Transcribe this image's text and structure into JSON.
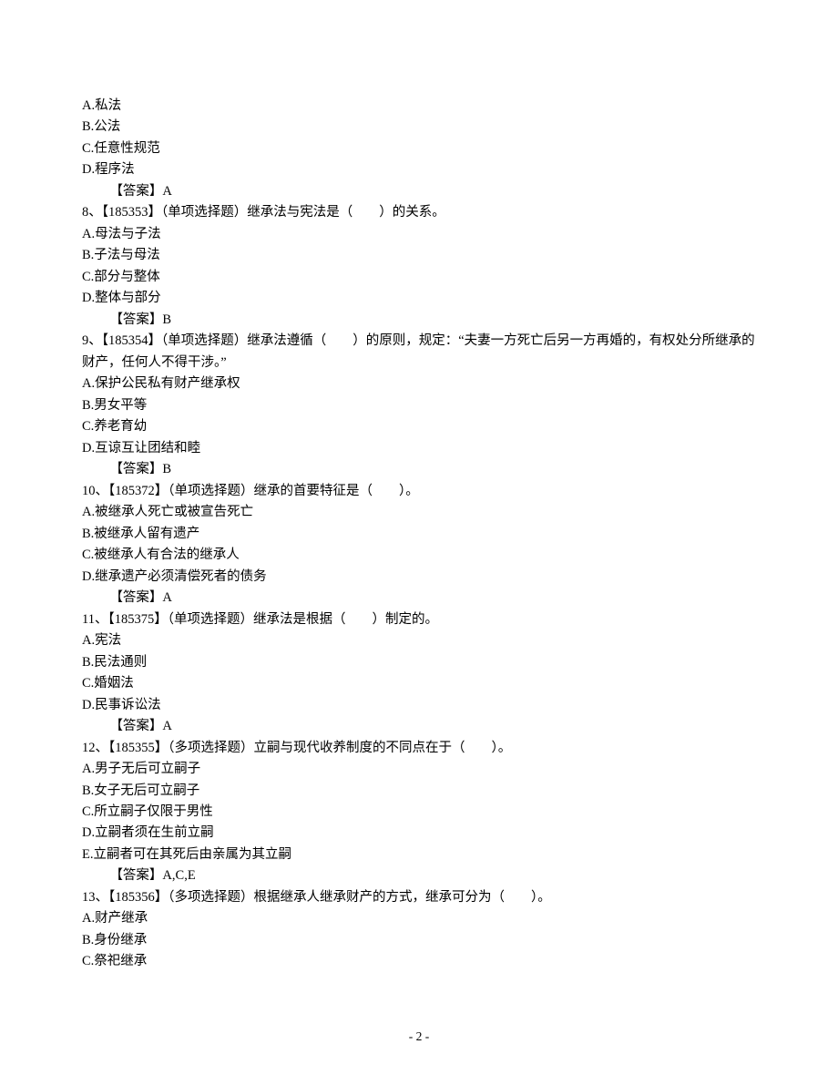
{
  "q7": {
    "optA": "A.私法",
    "optB": "B.公法",
    "optC": "C.任意性规范",
    "optD": "D.程序法",
    "answer": "【答案】A"
  },
  "q8": {
    "stem": "8、【185353】（单项选择题）继承法与宪法是（　　）的关系。",
    "optA": "A.母法与子法",
    "optB": "B.子法与母法",
    "optC": "C.部分与整体",
    "optD": "D.整体与部分",
    "answer": "【答案】B"
  },
  "q9": {
    "stem": "9、【185354】（单项选择题）继承法遵循（　　）的原则，规定：“夫妻一方死亡后另一方再婚的，有权处分所继承的财产，任何人不得干涉。”",
    "optA": "A.保护公民私有财产继承权",
    "optB": "B.男女平等",
    "optC": "C.养老育幼",
    "optD": "D.互谅互让团结和睦",
    "answer": "【答案】B"
  },
  "q10": {
    "stem": "10、【185372】（单项选择题）继承的首要特征是（　　）。",
    "optA": "A.被继承人死亡或被宣告死亡",
    "optB": "B.被继承人留有遗产",
    "optC": "C.被继承人有合法的继承人",
    "optD": "D.继承遗产必须清偿死者的债务",
    "answer": "【答案】A"
  },
  "q11": {
    "stem": "11、【185375】（单项选择题）继承法是根据（　　）制定的。",
    "optA": "A.宪法",
    "optB": "B.民法通则",
    "optC": "C.婚姻法",
    "optD": "D.民事诉讼法",
    "answer": "【答案】A"
  },
  "q12": {
    "stem": "12、【185355】（多项选择题）立嗣与现代收养制度的不同点在于（　　）。",
    "optA": "A.男子无后可立嗣子",
    "optB": "B.女子无后可立嗣子",
    "optC": "C.所立嗣子仅限于男性",
    "optD": "D.立嗣者须在生前立嗣",
    "optE": "E.立嗣者可在其死后由亲属为其立嗣",
    "answer": "【答案】A,C,E"
  },
  "q13": {
    "stem": "13、【185356】（多项选择题）根据继承人继承财产的方式，继承可分为（　　）。",
    "optA": "A.财产继承",
    "optB": "B.身份继承",
    "optC": "C.祭祀继承"
  },
  "footer": "- 2 -"
}
